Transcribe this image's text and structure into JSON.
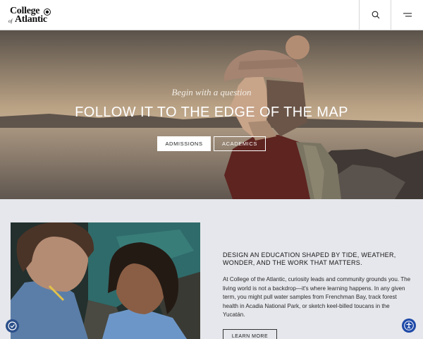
{
  "header": {
    "logo": {
      "line1": "College",
      "of": "of the",
      "line2": "Atlantic"
    },
    "search_icon": "search-icon",
    "menu_icon": "menu-icon"
  },
  "hero": {
    "kicker": "Begin with a question",
    "title": "FOLLOW IT TO THE EDGE OF THE MAP",
    "primary_button": "ADMISSIONS",
    "secondary_button": "ACADEMICS"
  },
  "intro": {
    "heading": "DESIGN AN EDUCATION SHAPED BY TIDE, WEATHER, WONDER, AND THE WORK THAT MATTERS.",
    "body": "At College of the Atlantic, curiosity leads and community grounds you. The living world is not a backdrop—it's where learning happens. In any given term, you might pull water samples from Frenchman Bay, track forest health in Acadia National Park, or sketch keel-billed toucans in the Yucatán.",
    "button": "LEARN MORE"
  },
  "widgets": {
    "left_icon": "accessibility-toggle-icon",
    "right_icon": "accessibility-person-icon"
  },
  "colors": {
    "page_background": "#e6e7ec",
    "header_background": "#ffffff",
    "accessibility_blue": "#1f4aa8"
  }
}
